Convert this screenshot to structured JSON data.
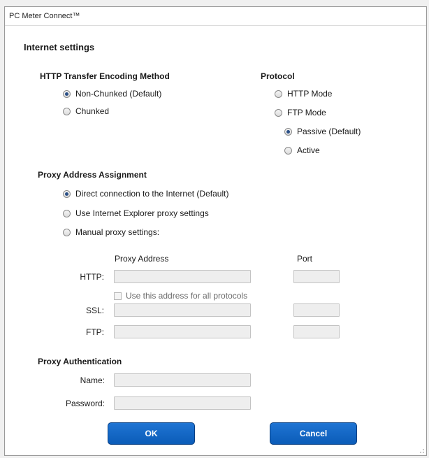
{
  "window": {
    "title": "PC Meter Connect™"
  },
  "header": {
    "title": "Internet settings"
  },
  "encoding": {
    "heading": "HTTP Transfer Encoding Method",
    "options": [
      {
        "label": "Non-Chunked  (Default)",
        "checked": true
      },
      {
        "label": "Chunked",
        "checked": false
      }
    ]
  },
  "protocol": {
    "heading": "Protocol",
    "options": [
      {
        "label": "HTTP Mode",
        "checked": false
      },
      {
        "label": "FTP Mode",
        "checked": false
      }
    ],
    "ftp_options": [
      {
        "label": "Passive (Default)",
        "checked": true
      },
      {
        "label": "Active",
        "checked": false
      }
    ]
  },
  "proxy": {
    "heading": "Proxy Address Assignment",
    "options": [
      {
        "label": "Direct connection to the Internet  (Default)",
        "checked": true
      },
      {
        "label": "Use Internet Explorer proxy settings",
        "checked": false
      },
      {
        "label": "Manual proxy settings:",
        "checked": false
      }
    ],
    "col_address": "Proxy Address",
    "col_port": "Port",
    "rows": [
      {
        "label": "HTTP:",
        "address": "",
        "port": ""
      },
      {
        "label": "SSL:",
        "address": "",
        "port": ""
      },
      {
        "label": "FTP:",
        "address": "",
        "port": ""
      }
    ],
    "use_all_label": "Use this address for all protocols",
    "use_all_checked": false
  },
  "auth": {
    "heading": "Proxy Authentication",
    "name_label": "Name:",
    "name_value": "",
    "password_label": "Password:",
    "password_value": ""
  },
  "buttons": {
    "ok": "OK",
    "cancel": "Cancel"
  },
  "colors": {
    "button": "#0b63c5",
    "radio_dot": "#2a4f86",
    "field_bg": "#eeeeee"
  },
  "icons": {
    "resize_grip": "resize-grip-icon"
  }
}
